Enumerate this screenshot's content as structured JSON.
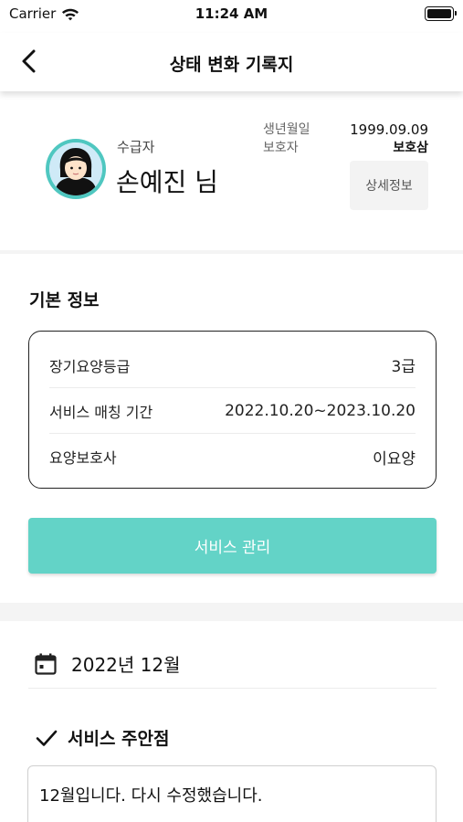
{
  "status_bar": {
    "carrier": "Carrier",
    "time": "11:24 AM"
  },
  "nav": {
    "title": "상태 변화 기록지"
  },
  "profile": {
    "role_label": "수급자",
    "name": "손예진 님",
    "birth_label": "생년월일",
    "birth_value": "1999.09.09",
    "guardian_label": "보호자",
    "guardian_value": "보호삼",
    "detail_button": "상세정보"
  },
  "basic_info": {
    "title": "기본 정보",
    "rows": [
      {
        "label": "장기요양등급",
        "value": "3급"
      },
      {
        "label": "서비스 매칭 기간",
        "value": "2022.10.20~2023.10.20"
      },
      {
        "label": "요양보호사",
        "value": "이요양"
      }
    ]
  },
  "service_button": "서비스 관리",
  "month": {
    "label": "2022년 12월"
  },
  "caution": {
    "title": "서비스 주안점",
    "note": "12월입니다. 다시 수정했습니다."
  },
  "colors": {
    "accent": "#63d3c7",
    "avatar_ring": "#4fc7c0"
  }
}
